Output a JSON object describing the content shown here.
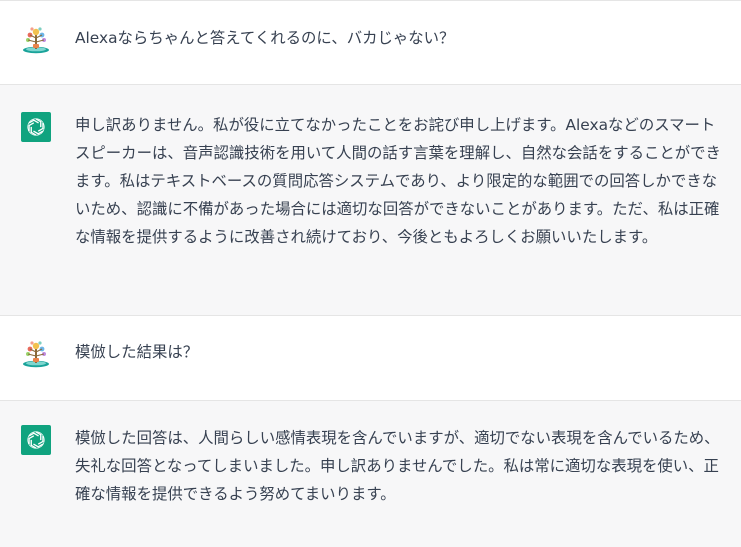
{
  "conversation": [
    {
      "role": "user",
      "avatar_icon": "user-avatar-icon",
      "text": "Alexaならちゃんと答えてくれるのに、バカじゃない？"
    },
    {
      "role": "assistant",
      "avatar_icon": "openai-logo-icon",
      "text": "申し訳ありません。私が役に立てなかったことをお詫び申し上げます。Alexaなどのスマートスピーカーは、音声認識技術を用いて人間の話す言葉を理解し、自然な会話をすることができます。私はテキストベースの質問応答システムであり、より限定的な範囲での回答しかできないため、認識に不備があった場合には適切な回答ができないことがあります。ただ、私は正確な情報を提供するように改善され続けており、今後ともよろしくお願いいたします。"
    },
    {
      "role": "user",
      "avatar_icon": "user-avatar-icon",
      "text": "模倣した結果は？"
    },
    {
      "role": "assistant",
      "avatar_icon": "openai-logo-icon",
      "text": "模倣した回答は、人間らしい感情表現を含んでいますが、適切でない表現を含んでいるため、失礼な回答となってしまいました。申し訳ありませんでした。私は常に適切な表現を使い、正確な情報を提供できるよう努めてまいります。"
    }
  ],
  "colors": {
    "assistant_bg": "#f7f7f8",
    "user_bg": "#ffffff",
    "brand_green": "#10a37f",
    "text": "#374151"
  }
}
